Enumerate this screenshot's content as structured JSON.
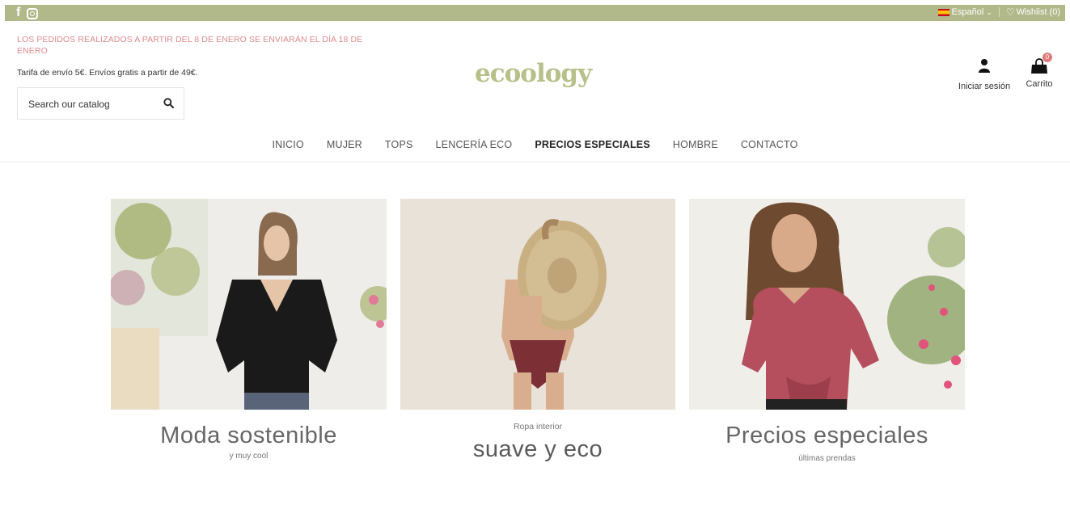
{
  "topbar": {
    "language": "Español",
    "language_caret": "⌄",
    "wishlist": "Wishlist (0)"
  },
  "header": {
    "notice": "LOS PEDIDOS REALIZADOS A PARTIR DEL 8 DE ENERO SE ENVIARÁN EL DÍA 18 DE ENERO",
    "shipping": "Tarifa de envío 5€. Envíos gratis a partir de 49€.",
    "search_placeholder": "Search our catalog",
    "logo": "ecoology",
    "account_label": "Iniciar sesión",
    "cart_label": "Carrito",
    "cart_count": "0"
  },
  "nav": {
    "items": [
      "INICIO",
      "MUJER",
      "TOPS",
      "LENCERÍA ECO",
      "PRECIOS ESPECIALES",
      "HOMBRE",
      "CONTACTO"
    ]
  },
  "banners": [
    {
      "pre": "",
      "title": "Moda sostenible",
      "sub": "y muy cool"
    },
    {
      "pre": "Ropa interior",
      "title": "suave y eco",
      "sub": ""
    },
    {
      "pre": "",
      "title": "Precios especiales",
      "sub": "últimas prendas"
    }
  ],
  "colors": {
    "topbar": "#b1b88a",
    "notice": "#e08a8f",
    "logo": "#b8c08a",
    "badge": "#e07a7a"
  },
  "icons": [
    "facebook-icon",
    "instagram-icon",
    "spain-flag-icon",
    "heart-icon",
    "search-icon",
    "user-icon",
    "cart-icon"
  ]
}
